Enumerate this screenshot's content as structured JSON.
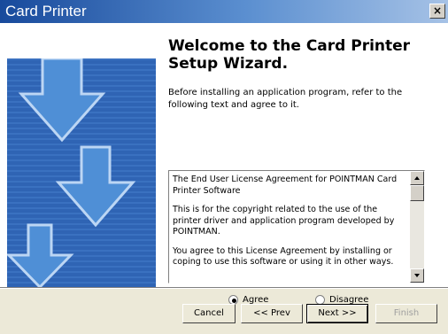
{
  "window": {
    "title": "Card Printer",
    "close_label": "×"
  },
  "heading": {
    "line1": "Welcome to the Card Printer",
    "line2": "Setup Wizard."
  },
  "intro": "Before installing an application program, refer to the following text and agree to it.",
  "license": {
    "paragraphs": [
      "The End User License Agreement for POINTMAN Card Printer Software",
      "This is for the copyright related to the use of the printer driver and application program developed by POINTMAN.",
      "You agree to this License Agreement by installing or coping to use this software or using it in other ways."
    ]
  },
  "options": {
    "agree": "Agree",
    "disagree": "Disagree",
    "selected": "agree"
  },
  "buttons": {
    "cancel": "Cancel",
    "prev": "<< Prev",
    "next": "Next >>",
    "finish": "Finish"
  },
  "colors": {
    "banner": "#2f64b4",
    "arrow_fill": "#4f8fd6",
    "arrow_stroke": "#bcd6f4"
  }
}
